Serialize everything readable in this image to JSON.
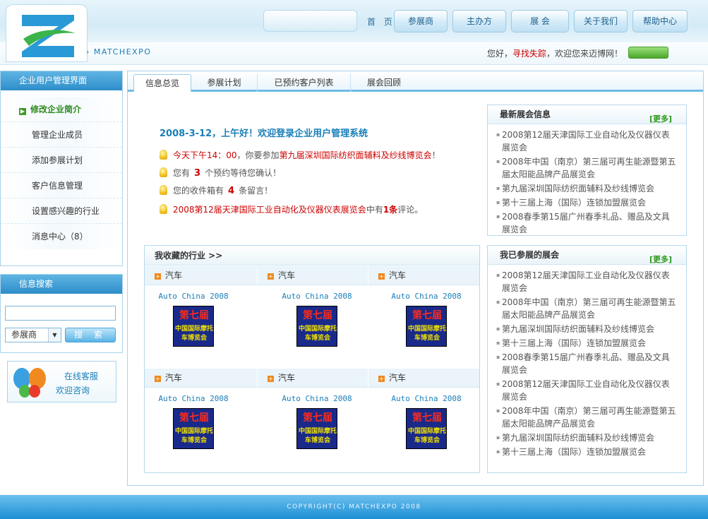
{
  "header": {
    "brand": "› MATCHEXPO",
    "nav_home": "首 页",
    "nav": [
      "参展商",
      "主办方",
      "展 会",
      "关于我们",
      "帮助中心"
    ],
    "greeting_prefix": "您好，",
    "greeting_user": "寻找失踪",
    "greeting_suffix": "，欢迎您来迈博网！"
  },
  "sidebar": {
    "title": "企业用户管理界面",
    "items": [
      "修改企业简介",
      "管理企业成员",
      "添加参展计划",
      "客户信息管理",
      "设置感兴趣的行业",
      "消息中心（8）"
    ],
    "search_title": "信息搜索",
    "search_value": "",
    "search_select": "参展商",
    "search_button": "搜 索",
    "service_line1": "在线客服",
    "service_line2": "欢迎咨询"
  },
  "tabs": [
    "信息总览",
    "参展计划",
    "已预约客户列表",
    "展会回顾"
  ],
  "overview": {
    "welcome": "2008-3-12，上午好！欢迎登录企业用户管理系统",
    "line1_time": "今天下午14：00",
    "line1_mid": "，你要参加",
    "line1_event": "第九届深圳国际纺织面辅料及纱线博览会",
    "line1_end": "！",
    "line2_pre": "您有",
    "line2_num": "3",
    "line2_post": "个预约等待您确认！",
    "line3_pre": "您的收件箱有",
    "line3_num": "4",
    "line3_post": "条留言！",
    "line4_event": "2008第12届天津国际工业自动化及仪器仪表展览会",
    "line4_mid": "中有",
    "line4_num": "1条",
    "line4_end": "评论。"
  },
  "latest": {
    "title": "最新展会信息",
    "more": "[更多]",
    "items": [
      "2008第12届天津国际工业自动化及仪器仪表展览会",
      "2008年中国（南京）第三届可再生能源暨第五届太阳能品牌产品展览会",
      "第九届深圳国际纺织面辅料及纱线博览会",
      "第十三届上海（国际）连锁加盟展览会",
      "2008春季第15届广州春季礼品、赠品及文具展览会"
    ]
  },
  "joined": {
    "title": "我已参展的展会",
    "more": "[更多]",
    "items": [
      "2008第12届天津国际工业自动化及仪器仪表展览会",
      "2008年中国（南京）第三届可再生能源暨第五届太阳能品牌产品展览会",
      "第九届深圳国际纺织面辅料及纱线博览会",
      "第十三届上海（国际）连锁加盟展览会",
      "2008春季第15届广州春季礼品、赠品及文具展览会",
      "2008第12届天津国际工业自动化及仪器仪表展览会",
      "2008年中国（南京）第三届可再生能源暨第五届太阳能品牌产品展览会",
      "第九届深圳国际纺织面辅料及纱线博览会",
      "第十三届上海（国际）连锁加盟展览会"
    ]
  },
  "industries": {
    "title": "我收藏的行业 >>",
    "rows": [
      {
        "cats": [
          "汽车",
          "汽车",
          "汽车"
        ],
        "products": [
          "Auto China 2008",
          "Auto China 2008",
          "Auto China 2008"
        ]
      },
      {
        "cats": [
          "汽车",
          "汽车",
          "汽车"
        ],
        "products": [
          "Auto China 2008",
          "Auto China 2008",
          "Auto China 2008"
        ]
      }
    ],
    "thumb_line1": "第七届",
    "thumb_line2": "中国国际摩托车博览会"
  },
  "footer": "COPYRIGHT(C) MATCHEXPO 2008",
  "colors": {
    "accent": "#1a7fb8",
    "alert": "#cc0000",
    "more": "#2c9a1c"
  }
}
